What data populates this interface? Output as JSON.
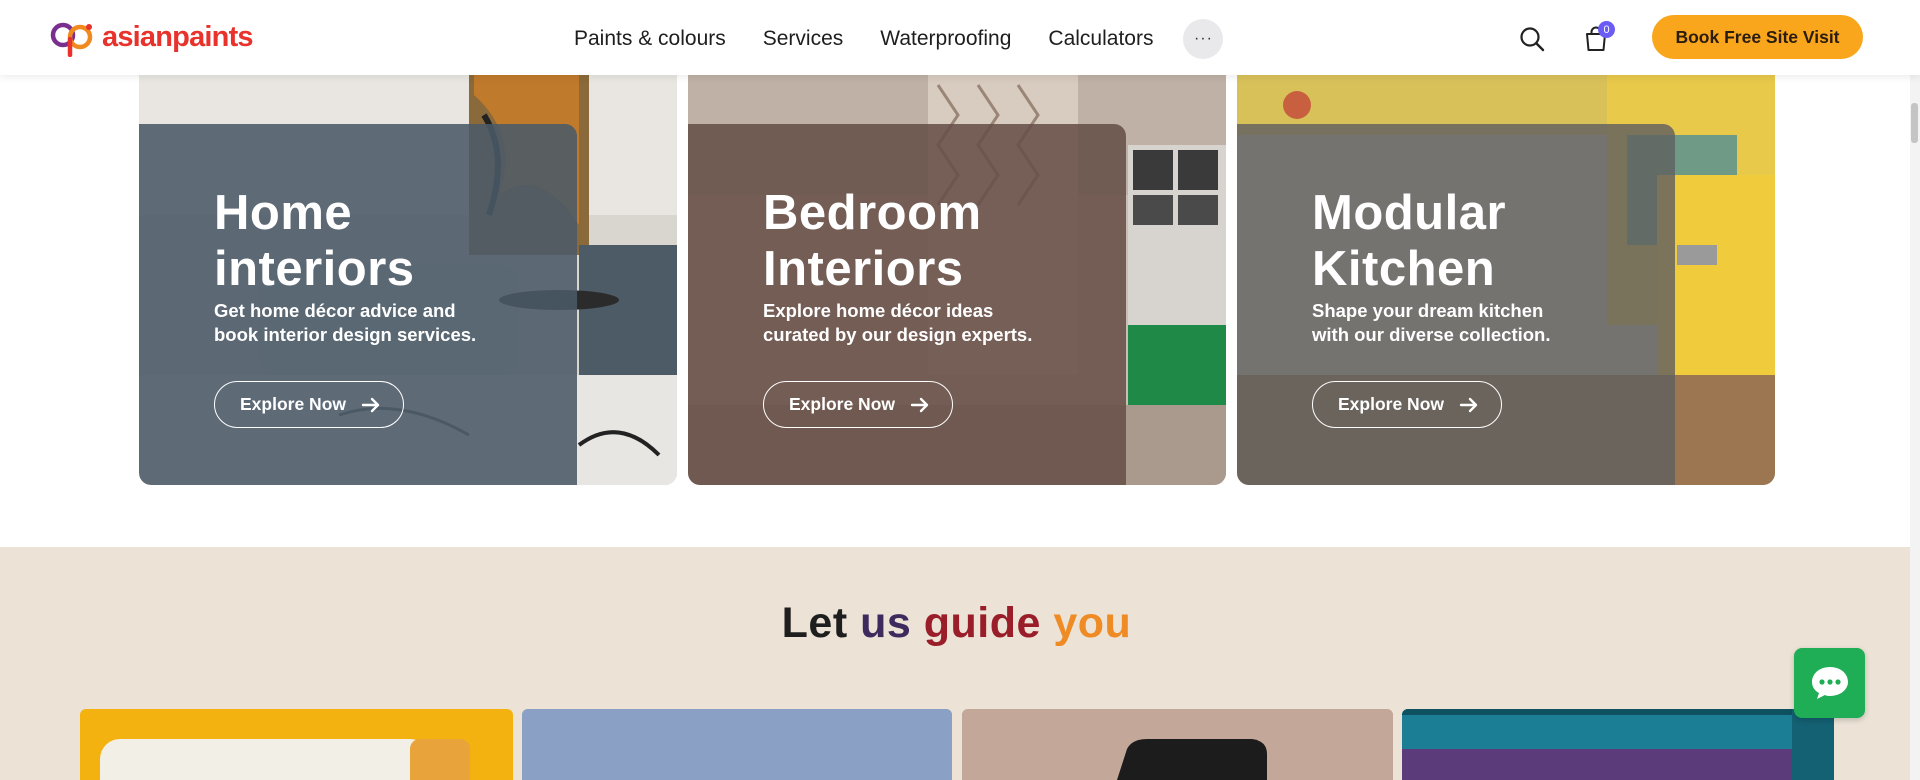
{
  "brand": {
    "name": "asianpaints",
    "color": "#e8322b"
  },
  "nav": {
    "items": [
      {
        "label": "Paints & colours"
      },
      {
        "label": "Services"
      },
      {
        "label": "Waterproofing"
      },
      {
        "label": "Calculators"
      }
    ],
    "more_label": "···"
  },
  "header": {
    "search_icon": "search-icon",
    "cart_icon": "shopping-bag-icon",
    "cart_count": "0",
    "cta_label": "Book Free Site Visit",
    "cta_color": "#f9a61d"
  },
  "cards": [
    {
      "title_line1": "Home",
      "title_line2": "interiors",
      "desc_line1": "Get home décor advice and",
      "desc_line2": "book interior design services.",
      "button_label": "Explore Now",
      "panel_color": "#55636f"
    },
    {
      "title_line1": "Bedroom",
      "title_line2": "Interiors",
      "desc_line1": "Explore home décor ideas",
      "desc_line2": "curated by our design experts.",
      "button_label": "Explore Now",
      "panel_color": "#6e5750"
    },
    {
      "title_line1": "Modular",
      "title_line2": "Kitchen",
      "desc_line1": "Shape your dream kitchen",
      "desc_line2": "with our diverse collection.",
      "button_label": "Explore Now",
      "panel_color": "#686866"
    }
  ],
  "guide": {
    "title_words": [
      "Let",
      "us",
      "guide",
      "you"
    ],
    "background": "#ece3d6"
  },
  "chat": {
    "icon": "chat-bubble-icon",
    "color": "#1fad56"
  }
}
